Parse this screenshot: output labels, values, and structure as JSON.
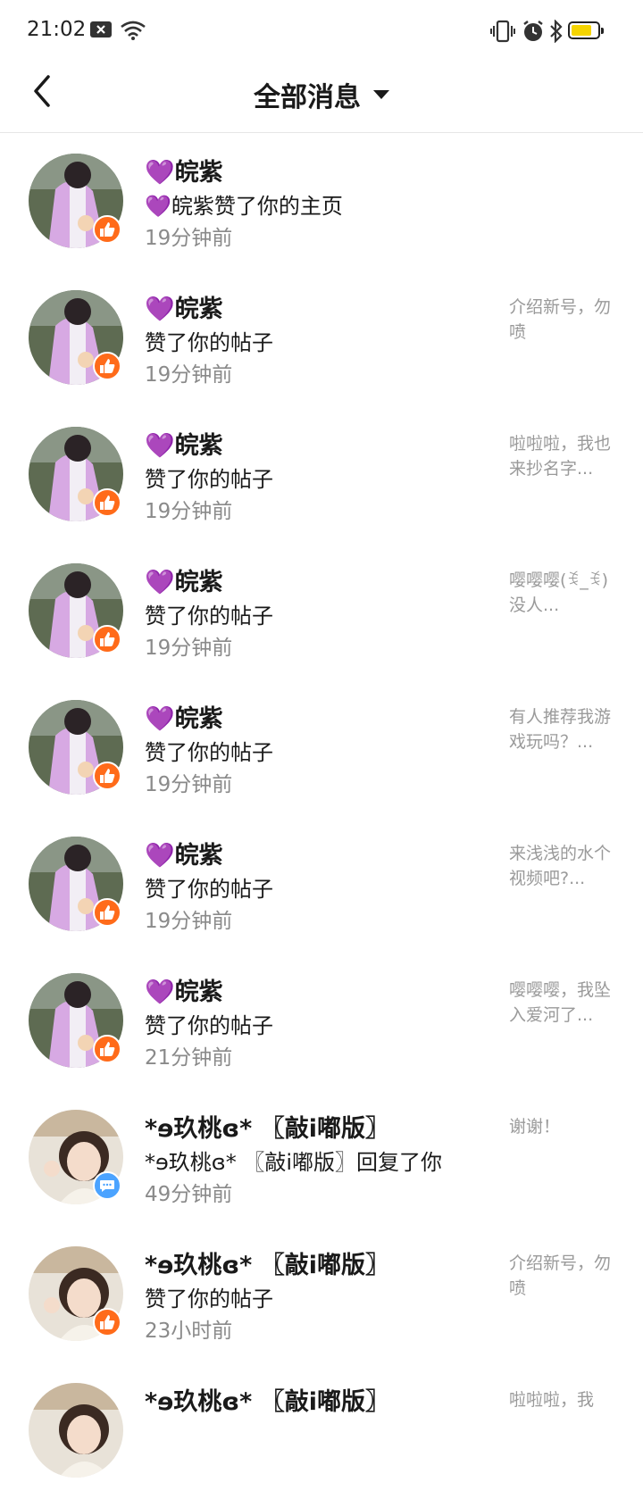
{
  "status_bar": {
    "time": "21:02"
  },
  "header": {
    "title": "全部消息"
  },
  "messages": [
    {
      "username": "💜皖紫",
      "action": "💜皖紫赞了你的主页",
      "time": "19分钟前",
      "preview": "",
      "badge": "like",
      "avatar": "purple"
    },
    {
      "username": "💜皖紫",
      "action": "赞了你的帖子",
      "time": "19分钟前",
      "preview": "介绍新号，勿喷",
      "badge": "like",
      "avatar": "purple"
    },
    {
      "username": "💜皖紫",
      "action": "赞了你的帖子",
      "time": "19分钟前",
      "preview": "啦啦啦，我也来抄名字...",
      "badge": "like",
      "avatar": "purple"
    },
    {
      "username": "💜皖紫",
      "action": "赞了你的帖子",
      "time": "19分钟前",
      "preview": "嘤嘤嘤(ꉂ_ꉂ)没人...",
      "badge": "like",
      "avatar": "purple"
    },
    {
      "username": "💜皖紫",
      "action": "赞了你的帖子",
      "time": "19分钟前",
      "preview": "有人推荐我游戏玩吗？...",
      "badge": "like",
      "avatar": "purple"
    },
    {
      "username": "💜皖紫",
      "action": "赞了你的帖子",
      "time": "19分钟前",
      "preview": "来浅浅的水个视频吧?...",
      "badge": "like",
      "avatar": "purple"
    },
    {
      "username": "💜皖紫",
      "action": "赞了你的帖子",
      "time": "21分钟前",
      "preview": "嘤嘤嘤，我坠入爱河了...",
      "badge": "like",
      "avatar": "purple"
    },
    {
      "username": "*ɘ玖桃ɞ* 〖敲i嘟版〗",
      "action": "*ɘ玖桃ɞ* 〖敲i嘟版〗回复了你",
      "time": "49分钟前",
      "preview": "谢谢！",
      "badge": "reply",
      "avatar": "girl"
    },
    {
      "username": "*ɘ玖桃ɞ* 〖敲i嘟版〗",
      "action": "赞了你的帖子",
      "time": "23小时前",
      "preview": "介绍新号，勿喷",
      "badge": "like",
      "avatar": "girl"
    },
    {
      "username": "*ɘ玖桃ɞ* 〖敲i嘟版〗",
      "action": "",
      "time": "",
      "preview": "啦啦啦，我",
      "badge": "",
      "avatar": "girl"
    }
  ]
}
